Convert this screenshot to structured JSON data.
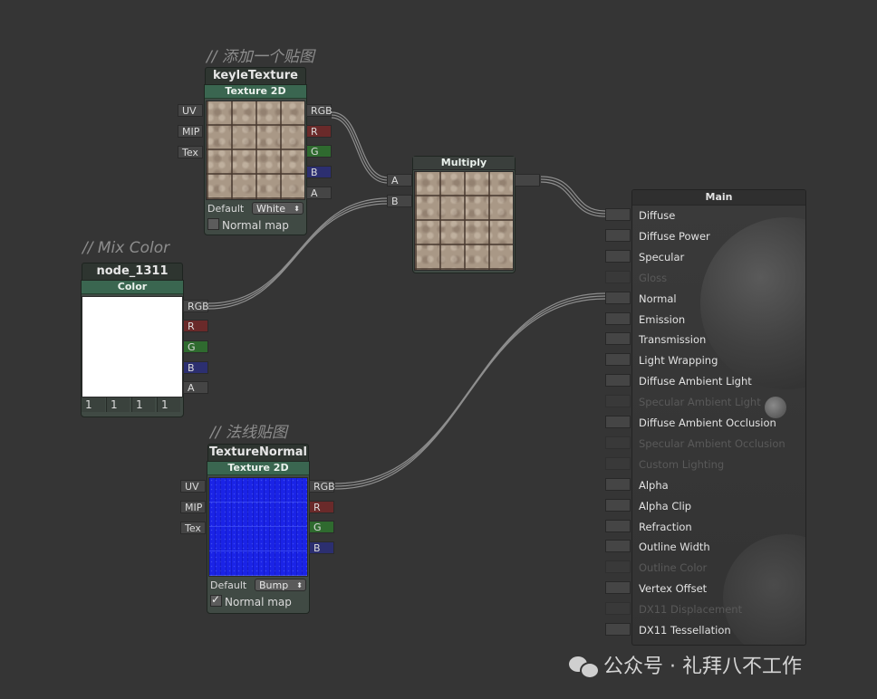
{
  "comments": {
    "add_texture": "// 添加一个贴图",
    "mix_color": "// Mix Color",
    "normal_map": "// 法线贴图"
  },
  "texture_node": {
    "title": "keyleTexture",
    "header": "Texture 2D",
    "inputs": [
      "UV",
      "MIP",
      "Tex"
    ],
    "outputs": [
      "RGB",
      "R",
      "G",
      "B",
      "A"
    ],
    "default_label": "Default",
    "default_value": "White",
    "normal_map_label": "Normal map",
    "normal_map_checked": false
  },
  "multiply_node": {
    "header": "Multiply",
    "inputs": [
      "A",
      "B"
    ]
  },
  "color_node": {
    "title": "node_1311",
    "header": "Color",
    "outputs": [
      "RGB",
      "R",
      "G",
      "B",
      "A"
    ],
    "values": [
      "1",
      "1",
      "1",
      "1"
    ]
  },
  "normal_node": {
    "title": "TextureNormal",
    "header": "Texture 2D",
    "inputs": [
      "UV",
      "MIP",
      "Tex"
    ],
    "outputs": [
      "RGB",
      "R",
      "G",
      "B"
    ],
    "default_label": "Default",
    "default_value": "Bump",
    "normal_map_label": "Normal map",
    "normal_map_checked": true
  },
  "main_node": {
    "title": "Main",
    "inputs": [
      {
        "label": "Diffuse",
        "enabled": true
      },
      {
        "label": "Diffuse Power",
        "enabled": true
      },
      {
        "label": "Specular",
        "enabled": true
      },
      {
        "label": "Gloss",
        "enabled": false
      },
      {
        "label": "Normal",
        "enabled": true
      },
      {
        "label": "Emission",
        "enabled": true
      },
      {
        "label": "Transmission",
        "enabled": true
      },
      {
        "label": "Light Wrapping",
        "enabled": true
      },
      {
        "label": "Diffuse Ambient Light",
        "enabled": true
      },
      {
        "label": "Specular Ambient Light",
        "enabled": false
      },
      {
        "label": "Diffuse Ambient Occlusion",
        "enabled": true
      },
      {
        "label": "Specular Ambient Occlusion",
        "enabled": false
      },
      {
        "label": "Custom Lighting",
        "enabled": false
      },
      {
        "label": "Alpha",
        "enabled": true
      },
      {
        "label": "Alpha Clip",
        "enabled": true
      },
      {
        "label": "Refraction",
        "enabled": true
      },
      {
        "label": "Outline Width",
        "enabled": true
      },
      {
        "label": "Outline Color",
        "enabled": false
      },
      {
        "label": "Vertex Offset",
        "enabled": true
      },
      {
        "label": "DX11 Displacement",
        "enabled": false
      },
      {
        "label": "DX11 Tessellation",
        "enabled": true
      }
    ]
  },
  "watermark": "公众号 · 礼拜八不工作",
  "colors": {
    "background": "#353535",
    "node_header": "#3a6650",
    "wire": "#8a8a8a"
  }
}
